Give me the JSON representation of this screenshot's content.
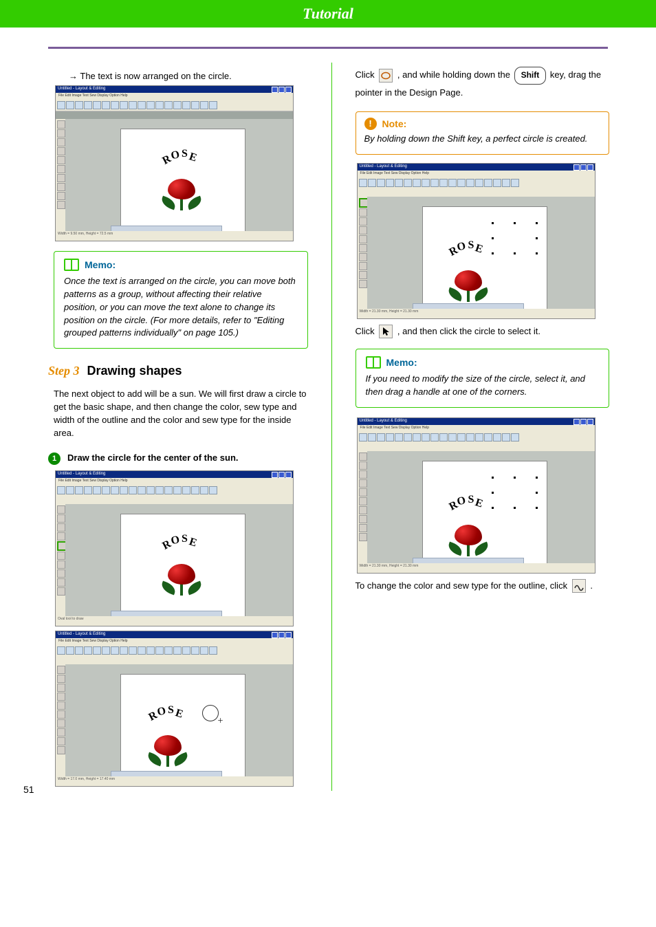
{
  "header": {
    "title": "Tutorial"
  },
  "page_number": "51",
  "col_left": {
    "arrow_line": "→ The text is now arranged on the circle.",
    "screenshot1": {
      "window_title": "Untitled - Layout & Editing",
      "menu": "File  Edit  Image  Text  Sew  Display  Option  Help",
      "arc_text": "ROSE",
      "status": "Width = 9.50 mm, Height = 72.5 mm"
    },
    "memo1": {
      "label": "Memo:",
      "body": "Once the text is arranged on the circle, you can move both patterns as a group, without affecting their relative position, or you can move the text alone to change its position on the circle. (For more details, refer to \"Editing grouped patterns individually\" on page 105.)"
    },
    "step": {
      "label": "Step 3",
      "title": "Drawing shapes"
    },
    "intro": "The next object to add will be a sun. We will first draw a circle to get the basic shape, and then change the color, sew type and width of the outline and the color and sew type for the inside area.",
    "sub1": {
      "num": "1",
      "text": "Draw the circle for the center of the sun."
    },
    "screenshot2": {
      "window_title": "Untitled - Layout & Editing",
      "menu": "File  Edit  Image  Text  Sew  Display  Option  Help",
      "arc_text": "ROSE",
      "status": "Oval tool to draw"
    },
    "screenshot3": {
      "window_title": "Untitled - Layout & Editing",
      "menu": "File  Edit  Image  Text  Sew  Display  Option  Help",
      "arc_text": "ROSE",
      "status": "Width = 17.0 mm, Height = 17.40 mm"
    }
  },
  "col_right": {
    "para1_a": "Click ",
    "para1_b": " , and while holding down the ",
    "shift_key": "Shift",
    "para1_c": " key, drag the pointer in the Design Page.",
    "note": {
      "label": "Note:",
      "body": "By holding down the Shift key, a perfect circle is created."
    },
    "screenshot4": {
      "window_title": "Untitled - Layout & Editing",
      "menu": "File  Edit  Image  Text  Sew  Display  Option  Help",
      "arc_text": "ROSE",
      "status": "Width = 21.30 mm, Height = 21.30 mm"
    },
    "para2_a": "Click ",
    "para2_b": " , and then click the circle to select it.",
    "memo2": {
      "label": "Memo:",
      "body": "If you need to modify the size of the circle, select it, and then drag a handle at one of the corners."
    },
    "screenshot5": {
      "window_title": "Untitled - Layout & Editing",
      "menu": "File  Edit  Image  Text  Sew  Display  Option  Help",
      "arc_text": "ROSE",
      "status": "Width = 21.30 mm, Height = 21.30 mm"
    },
    "para3_a": "To change the color and sew type for the outline, click ",
    "para3_b": " ."
  }
}
